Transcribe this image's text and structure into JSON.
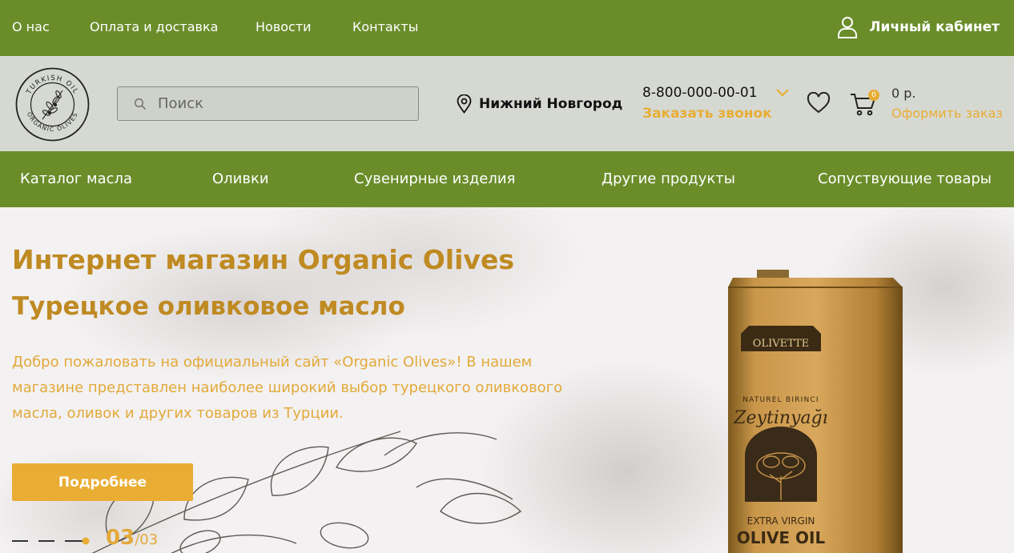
{
  "top_nav": {
    "items": [
      {
        "label": "О нас"
      },
      {
        "label": "Оплата и доставка"
      },
      {
        "label": "Новости"
      },
      {
        "label": "Контакты"
      }
    ],
    "account_label": "Личный кабинет"
  },
  "header": {
    "logo": {
      "top_text": "TURKISH OIL",
      "bottom_text": "ORGANIC OLIVES"
    },
    "search_placeholder": "Поиск",
    "city": "Нижний Новгород",
    "phone": "8-800-000-00-01",
    "callback_label": "Заказать звонок",
    "cart_count": "0",
    "cart_total": "0 р.",
    "checkout_label": "Оформить заказ"
  },
  "category_nav": {
    "items": [
      {
        "label": "Каталог масла"
      },
      {
        "label": "Оливки"
      },
      {
        "label": "Сувенирные изделия"
      },
      {
        "label": "Другие продукты"
      },
      {
        "label": "Сопуствующие товары"
      }
    ]
  },
  "hero": {
    "title": "Интернет магазин Organic Olives",
    "subtitle": "Турецкое оливковое масло",
    "text": "Добро пожаловать на официальный сайт «Organic Olives»! В нашем магазине представлен наиболее широкий выбор турецкого оливкового масла, оливок и других товаров из Турции.",
    "button_label": "Подробнее",
    "slide_current": "03",
    "slide_total": "/03",
    "product_label": {
      "brand": "OLIVETTE",
      "line1": "NATUREL BIRINCI",
      "line2": "Zeytinyağı",
      "line3": "EXTRA VIRGIN",
      "line4": "OLIVE OIL"
    }
  },
  "colors": {
    "green": "#6a8d2a",
    "header_gray": "#d6d9d2",
    "accent": "#e9ad33",
    "title_gold": "#bf8a22"
  }
}
